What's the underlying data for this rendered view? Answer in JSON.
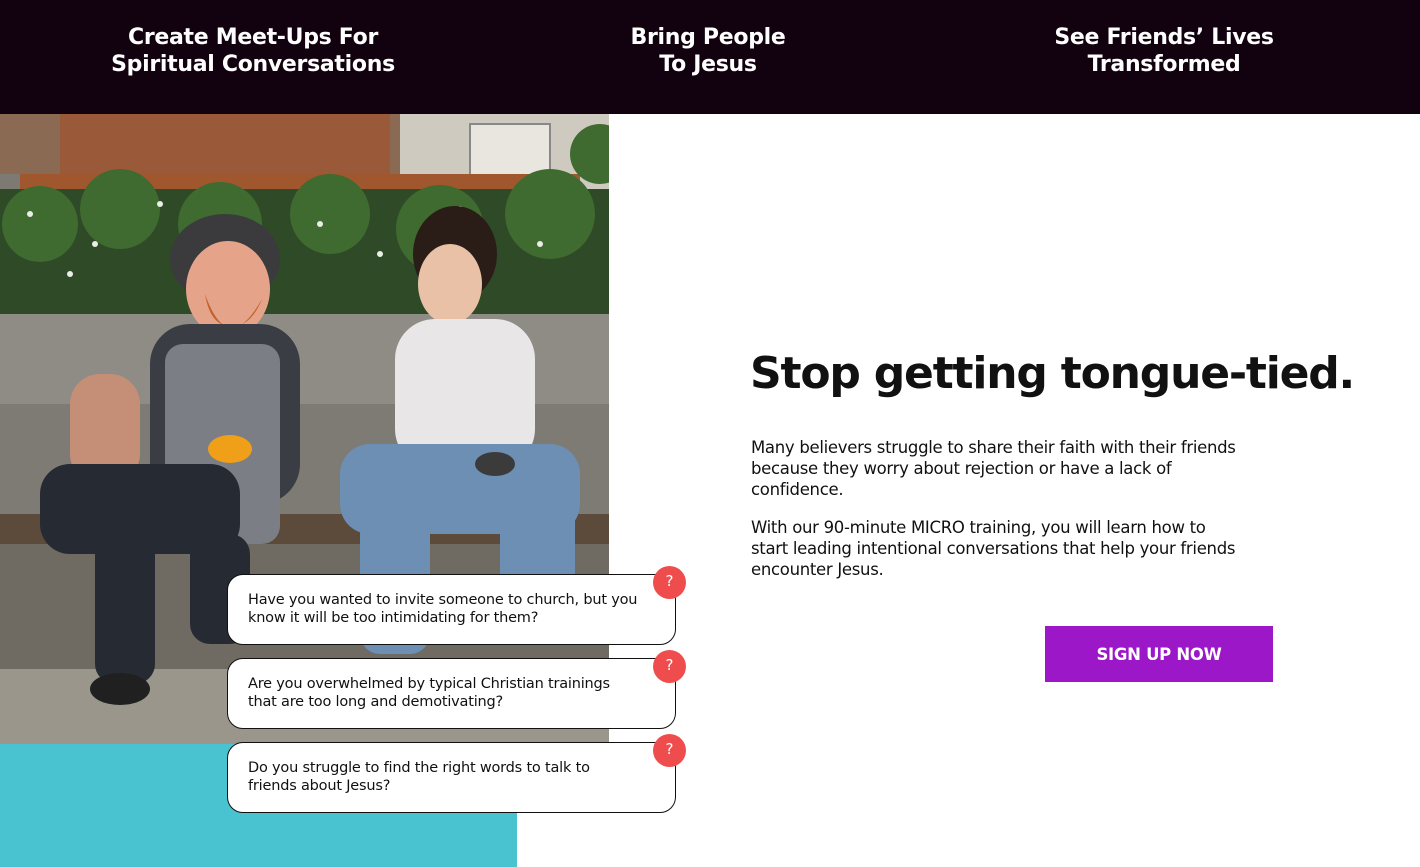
{
  "banner": {
    "items": [
      {
        "line1": "Create Meet-Ups For",
        "line2": "Spiritual Conversations"
      },
      {
        "line1": "Bring People",
        "line2": "To Jesus"
      },
      {
        "line1": "See Friends’ Lives",
        "line2": "Transformed"
      }
    ]
  },
  "questions": [
    {
      "text": "Have you wanted to invite someone to church, but you know it will be too intimidating for them?",
      "badge": "?"
    },
    {
      "text": "Are you overwhelmed by typical Christian trainings that are too long and demotivating?",
      "badge": "?"
    },
    {
      "text": "Do you struggle to find the right words to talk to friends about Jesus?",
      "badge": "?"
    }
  ],
  "main": {
    "headline": "Stop getting tongue-tied.",
    "paragraph1": "Many believers struggle to share their faith with their friends because they worry about rejection or have a lack of confidence.",
    "paragraph2": "With our 90-minute MICRO training, you will learn how to start leading intentional conversations that help your friends encounter Jesus.",
    "cta_label": "SIGN UP NOW"
  },
  "colors": {
    "banner_bg": "#12010e",
    "cta": "#9b17c8",
    "badge": "#ef4d4d",
    "teal": "#49c3cf"
  }
}
